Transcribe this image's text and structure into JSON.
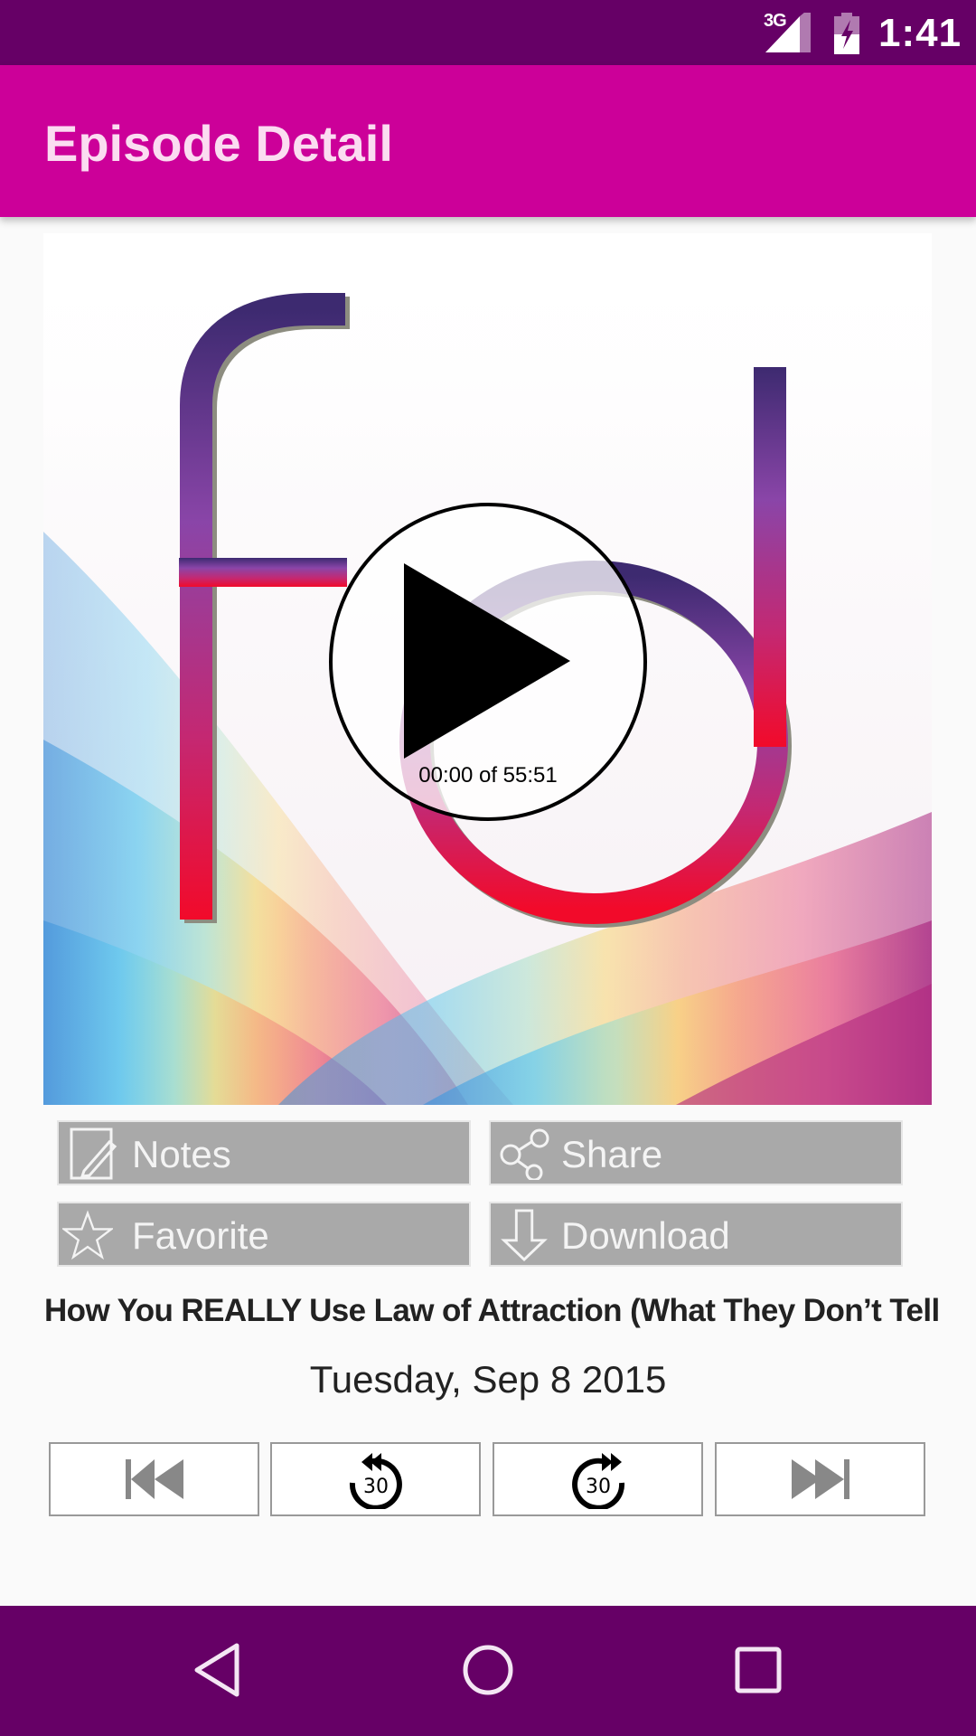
{
  "status_bar": {
    "network": "3G",
    "network_icon": "signal-icon",
    "battery_icon": "battery-charging-icon",
    "time": "1:41"
  },
  "app_bar": {
    "title": "Episode Detail"
  },
  "player": {
    "artwork_icon": "podcast-artwork-fd-logo",
    "play_icon": "play-icon",
    "elapsed": "00:00",
    "duration": "55:51",
    "progress_text": "00:00 of 55:51"
  },
  "actions": [
    {
      "label": "Notes",
      "icon": "notes-icon"
    },
    {
      "label": "Share",
      "icon": "share-icon"
    },
    {
      "label": "Favorite",
      "icon": "star-icon"
    },
    {
      "label": "Download",
      "icon": "download-icon"
    }
  ],
  "episode": {
    "title": "How You REALLY Use Law of Attraction (What They Don’t Tell",
    "date": "Tuesday, Sep 8 2015"
  },
  "transport": [
    {
      "name": "previous",
      "icon": "skip-previous-icon"
    },
    {
      "name": "rewind-30",
      "icon": "replay-30-icon",
      "seconds": "30"
    },
    {
      "name": "forward-30",
      "icon": "forward-30-icon",
      "seconds": "30"
    },
    {
      "name": "next",
      "icon": "skip-next-icon"
    }
  ],
  "nav_bar": {
    "back_icon": "back-icon",
    "home_icon": "home-icon",
    "recents_icon": "recents-icon"
  },
  "colors": {
    "status_bar": "#660066",
    "app_bar": "#CC0099",
    "app_bar_title": "#FBDCF1",
    "action_button": "#A9A9A9",
    "nav_bar": "#660066"
  }
}
